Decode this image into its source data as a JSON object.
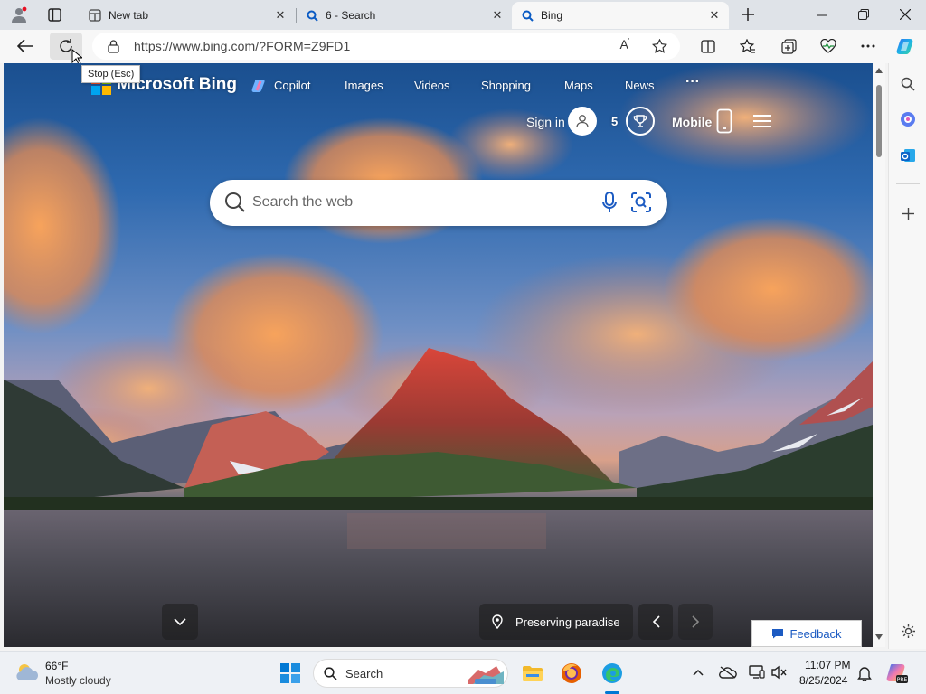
{
  "tabs": [
    {
      "title": "New tab",
      "icon": "new-tab-icon",
      "active": false
    },
    {
      "title": "6 - Search",
      "icon": "search-icon",
      "active": false
    },
    {
      "title": "Bing",
      "icon": "search-icon",
      "active": true
    }
  ],
  "address": {
    "url": "https://www.bing.com/?FORM=Z9FD1"
  },
  "tooltip": "Stop (Esc)",
  "bing": {
    "logo": "Microsoft Bing",
    "nav": [
      "Copilot",
      "Images",
      "Videos",
      "Shopping",
      "Maps",
      "News"
    ],
    "more": "···",
    "sign_in": "Sign in",
    "rewards_count": "5",
    "mobile": "Mobile",
    "search_placeholder": "Search the web",
    "image_caption": "Preserving paradise",
    "feedback": "Feedback"
  },
  "taskbar": {
    "weather_temp": "66°F",
    "weather_desc": "Mostly cloudy",
    "search_label": "Search",
    "time": "11:07 PM",
    "date": "8/25/2024"
  },
  "colors": {
    "accent": "#0078d4",
    "tabstrip": "#dfe3e8",
    "toolbar": "#f7f7f7"
  }
}
